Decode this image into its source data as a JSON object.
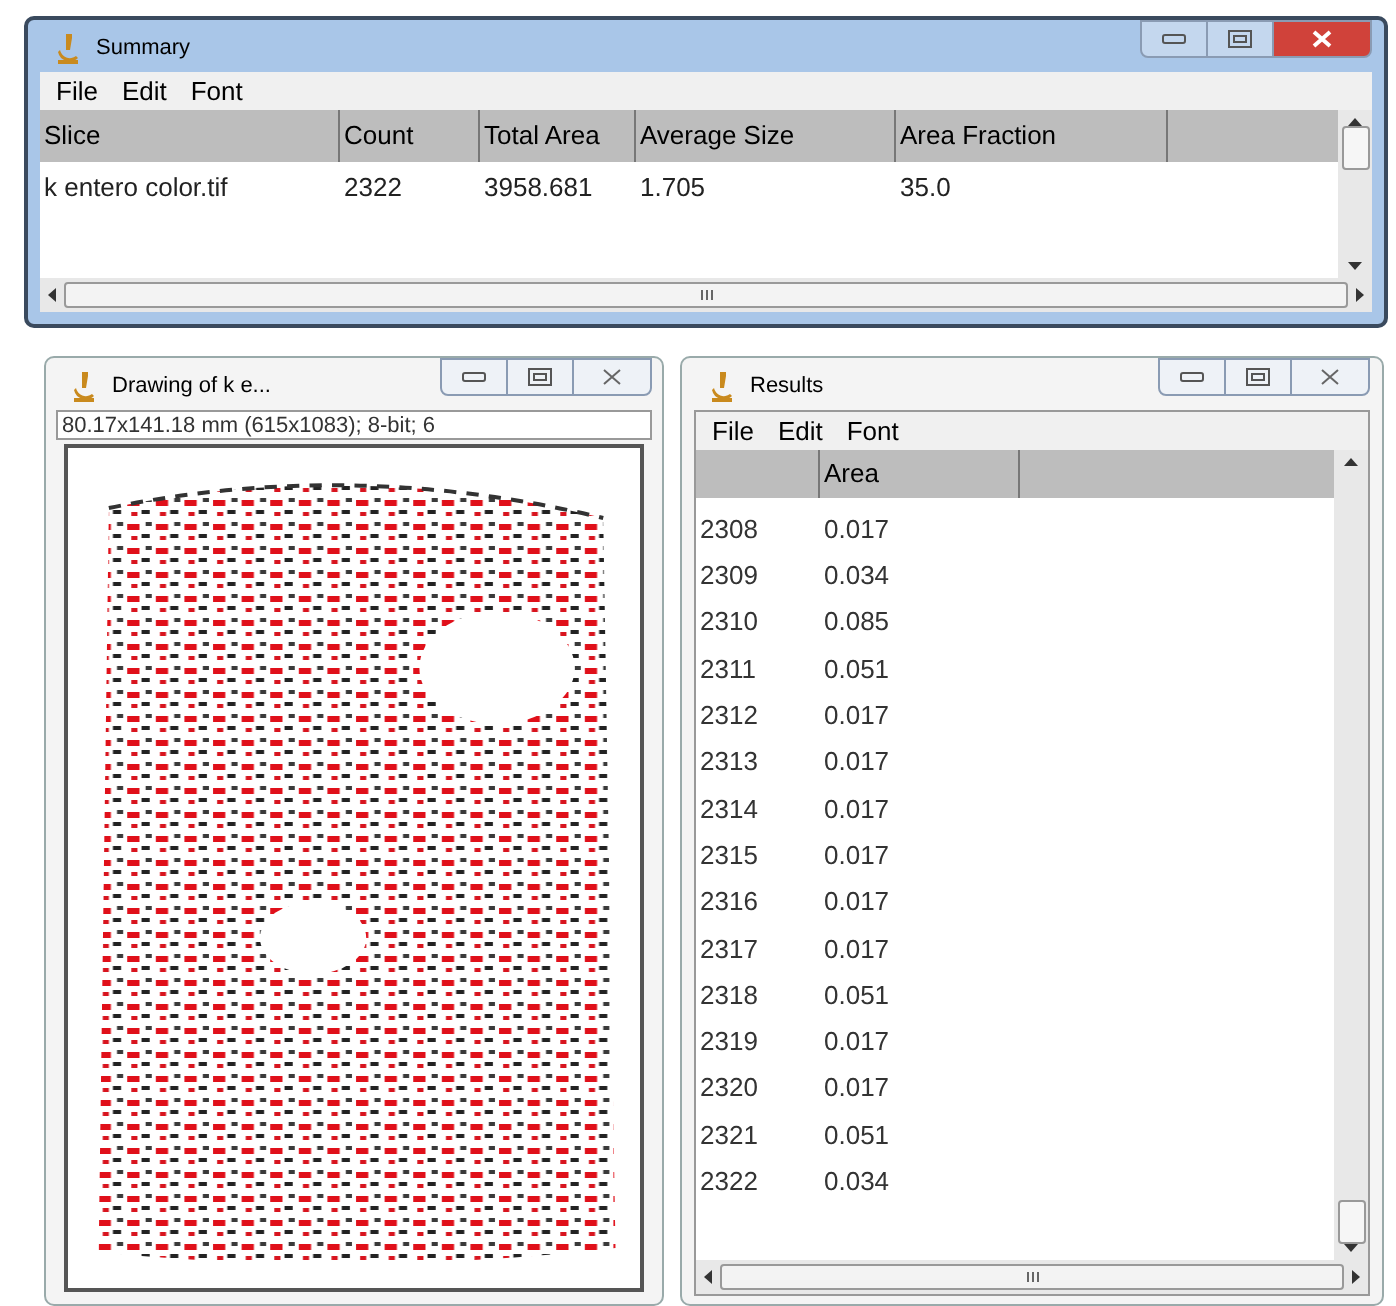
{
  "summary": {
    "title": "Summary",
    "menu": [
      "File",
      "Edit",
      "Font"
    ],
    "columns": [
      "Slice",
      "Count",
      "Total Area",
      "Average Size",
      "Area Fraction"
    ],
    "rows": [
      [
        "k entero color.tif",
        "2322",
        "3958.681",
        "1.705",
        "35.0"
      ]
    ]
  },
  "drawing": {
    "title": "Drawing of k e...",
    "info": "80.17x141.18 mm (615x1083); 8-bit; 6"
  },
  "results": {
    "title": "Results",
    "menu": [
      "File",
      "Edit",
      "Font"
    ],
    "columns": [
      "",
      "Area"
    ],
    "rows": [
      [
        "2308",
        "0.017"
      ],
      [
        "2309",
        "0.034"
      ],
      [
        "2310",
        "0.085"
      ],
      [
        "2311",
        "0.051"
      ],
      [
        "2312",
        "0.017"
      ],
      [
        "2313",
        "0.017"
      ],
      [
        "2314",
        "0.017"
      ],
      [
        "2315",
        "0.017"
      ],
      [
        "2316",
        "0.017"
      ],
      [
        "2317",
        "0.017"
      ],
      [
        "2318",
        "0.051"
      ],
      [
        "2319",
        "0.017"
      ],
      [
        "2320",
        "0.017"
      ],
      [
        "2321",
        "0.051"
      ],
      [
        "2322",
        "0.034"
      ]
    ]
  }
}
